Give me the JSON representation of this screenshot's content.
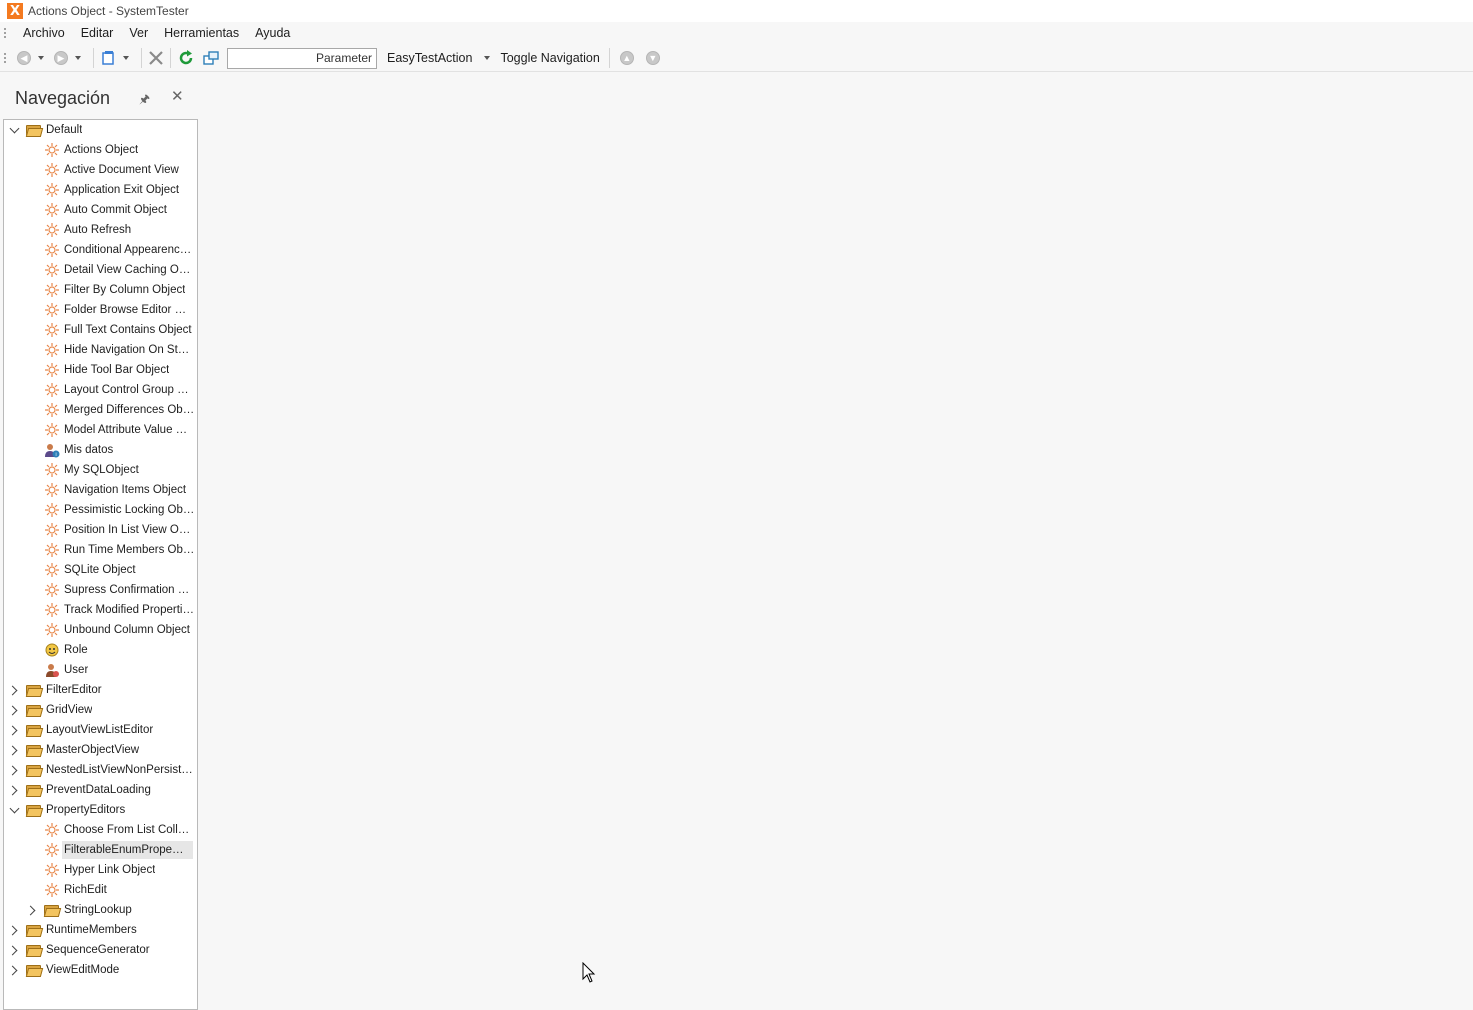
{
  "window": {
    "title": "Actions Object - SystemTester",
    "logo_letter": "X"
  },
  "menu": [
    "Archivo",
    "Editar",
    "Ver",
    "Herramientas",
    "Ayuda"
  ],
  "toolbar": {
    "parameter_label": "Parameter",
    "easytest_label": "EasyTestAction",
    "toggle_label": "Toggle Navigation"
  },
  "navigation": {
    "title": "Navegación",
    "items": [
      {
        "label": "Default",
        "level": 0,
        "type": "folder",
        "state": "expanded"
      },
      {
        "label": "Actions Object",
        "level": 1,
        "type": "object"
      },
      {
        "label": "Active Document View",
        "level": 1,
        "type": "object"
      },
      {
        "label": "Application Exit Object",
        "level": 1,
        "type": "object"
      },
      {
        "label": "Auto Commit Object",
        "level": 1,
        "type": "object"
      },
      {
        "label": "Auto Refresh",
        "level": 1,
        "type": "object"
      },
      {
        "label": "Conditional Appearence ...",
        "level": 1,
        "type": "object"
      },
      {
        "label": "Detail View Caching Object",
        "level": 1,
        "type": "object"
      },
      {
        "label": "Filter By Column Object",
        "level": 1,
        "type": "object"
      },
      {
        "label": "Folder Browse Editor Obj...",
        "level": 1,
        "type": "object"
      },
      {
        "label": "Full Text Contains Object",
        "level": 1,
        "type": "object"
      },
      {
        "label": "Hide Navigation On Start...",
        "level": 1,
        "type": "object"
      },
      {
        "label": "Hide Tool Bar Object",
        "level": 1,
        "type": "object"
      },
      {
        "label": "Layout Control Group Obj...",
        "level": 1,
        "type": "object"
      },
      {
        "label": "Merged Differences Object",
        "level": 1,
        "type": "object"
      },
      {
        "label": "Model Attribute Value Obj...",
        "level": 1,
        "type": "object"
      },
      {
        "label": "Mis datos",
        "level": 1,
        "type": "user-info"
      },
      {
        "label": "My SQLObject",
        "level": 1,
        "type": "object"
      },
      {
        "label": "Navigation Items Object",
        "level": 1,
        "type": "object"
      },
      {
        "label": "Pessimistic Locking Object",
        "level": 1,
        "type": "object"
      },
      {
        "label": "Position In List View Object",
        "level": 1,
        "type": "object"
      },
      {
        "label": "Run Time Members Object",
        "level": 1,
        "type": "object"
      },
      {
        "label": "SQLite Object",
        "level": 1,
        "type": "object"
      },
      {
        "label": "Supress Confirmation Obj...",
        "level": 1,
        "type": "object"
      },
      {
        "label": "Track Modified Properties...",
        "level": 1,
        "type": "object"
      },
      {
        "label": "Unbound Column Object",
        "level": 1,
        "type": "object"
      },
      {
        "label": "Role",
        "level": 1,
        "type": "role"
      },
      {
        "label": "User",
        "level": 1,
        "type": "user"
      },
      {
        "label": "FilterEditor",
        "level": 0,
        "type": "folder",
        "state": "collapsed"
      },
      {
        "label": "GridView",
        "level": 0,
        "type": "folder",
        "state": "collapsed"
      },
      {
        "label": "LayoutViewListEditor",
        "level": 0,
        "type": "folder",
        "state": "collapsed"
      },
      {
        "label": "MasterObjectView",
        "level": 0,
        "type": "folder",
        "state": "collapsed"
      },
      {
        "label": "NestedListViewNonPersistent...",
        "level": 0,
        "type": "folder",
        "state": "collapsed"
      },
      {
        "label": "PreventDataLoading",
        "level": 0,
        "type": "folder",
        "state": "collapsed"
      },
      {
        "label": "PropertyEditors",
        "level": 0,
        "type": "folder",
        "state": "expanded"
      },
      {
        "label": "Choose From List Collecti...",
        "level": 1,
        "type": "object"
      },
      {
        "label": "FilterableEnumPropertyE...",
        "level": 1,
        "type": "object",
        "selected": true
      },
      {
        "label": "Hyper Link Object",
        "level": 1,
        "type": "object"
      },
      {
        "label": "RichEdit",
        "level": 1,
        "type": "object"
      },
      {
        "label": "StringLookup",
        "level": 1,
        "type": "folder",
        "state": "collapsed"
      },
      {
        "label": "RuntimeMembers",
        "level": 0,
        "type": "folder",
        "state": "collapsed"
      },
      {
        "label": "SequenceGenerator",
        "level": 0,
        "type": "folder",
        "state": "collapsed"
      },
      {
        "label": "ViewEditMode",
        "level": 0,
        "type": "folder",
        "state": "collapsed"
      }
    ]
  },
  "colors": {
    "accent": "#f47a20",
    "object_icon": "#e8874a",
    "folder": "#f3c45f"
  }
}
